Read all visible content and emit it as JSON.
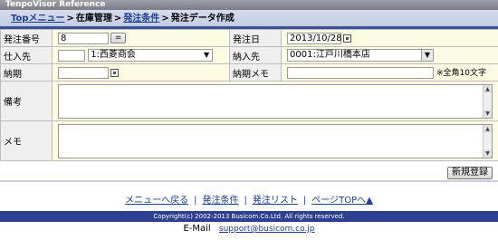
{
  "app": {
    "title": "TenpoVisor Reference"
  },
  "breadcrumb": {
    "top": "Topメニュー",
    "sep": ">",
    "inventory": "在庫管理",
    "order_terms": "発注条件",
    "current": "発注データ作成"
  },
  "form": {
    "order_no": {
      "label": "発注番号",
      "value": "8",
      "button": "="
    },
    "order_date": {
      "label": "発注日",
      "value": "2013/10/28"
    },
    "supplier": {
      "label": "仕入先",
      "code": "",
      "name": "1:西菱商会"
    },
    "delivery_to": {
      "label": "納入先",
      "value": "0001:江戸川橋本店"
    },
    "delivery_date": {
      "label": "納期",
      "value": ""
    },
    "delivery_memo": {
      "label": "納期メモ",
      "value": "",
      "note": "※全角10文字"
    },
    "remarks": {
      "label": "備考",
      "value": ""
    },
    "memo": {
      "label": "メモ",
      "value": ""
    }
  },
  "actions": {
    "register": "新規登録"
  },
  "footer_links": [
    {
      "label": "メニューへ戻る"
    },
    {
      "label": "発注条件"
    },
    {
      "label": "発注リスト"
    },
    {
      "label": "ページTOPへ▲"
    }
  ],
  "link_separator": "|",
  "footer": {
    "copyright": "Copyright(c) 2002-2013 Busicom.Co.Ltd. All rights reserved.",
    "mail_label": "E-Mail",
    "mail_address": "support@busicom.co.jp"
  }
}
